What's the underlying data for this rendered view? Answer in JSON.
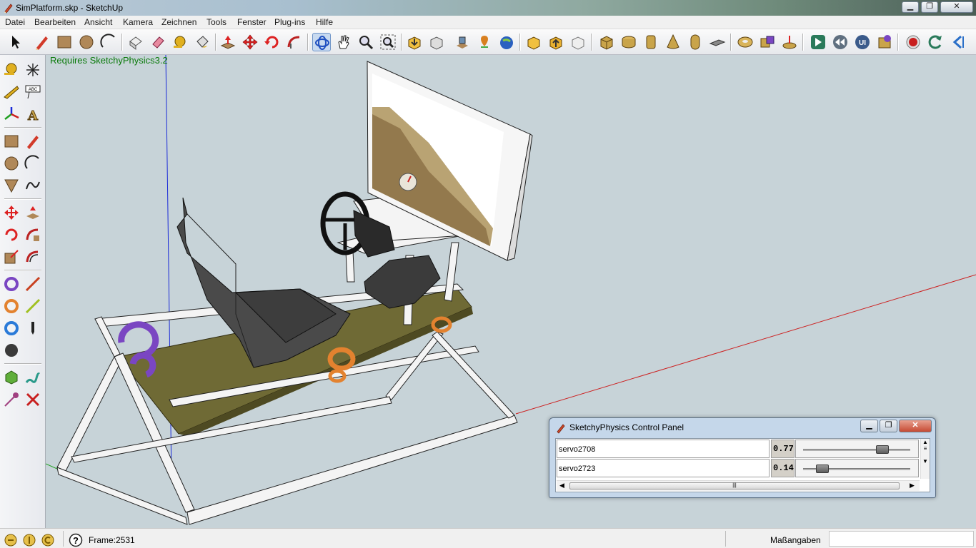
{
  "window": {
    "title": "SimPlatform.skp - SketchUp",
    "app_icon": "sketchup-pencil-icon"
  },
  "menu": {
    "items": [
      "Datei",
      "Bearbeiten",
      "Ansicht",
      "Kamera",
      "Zeichnen",
      "Tools",
      "Fenster",
      "Plug-ins",
      "Hilfe"
    ]
  },
  "toolbar": {
    "icons": [
      "select-arrow-icon",
      "pencil-line-icon",
      "rectangle-icon",
      "circle-icon",
      "arc-icon",
      "make-component-icon",
      "eraser-icon",
      "tape-measure-icon",
      "paint-bucket-icon",
      "push-pull-icon",
      "move-icon",
      "rotate-icon",
      "follow-me-icon",
      "orbit-icon",
      "pan-hand-icon",
      "zoom-icon",
      "zoom-extents-icon",
      "get-models-icon",
      "share-model-icon",
      "google-earth-icon",
      "add-location-icon",
      "toggle-terrain-icon",
      "get-photo-texture-icon",
      "share-component-icon",
      "preview-model-icon",
      "box-solid-icon",
      "cylinder-solid-icon",
      "tube-solid-icon",
      "cone-solid-icon",
      "capsule-solid-icon",
      "plate-solid-icon",
      "torus-solid-icon",
      "joint-connector-icon",
      "lift-icon",
      "play-simulation-icon",
      "rewind-simulation-icon",
      "ui-control-icon",
      "physics-settings-icon",
      "record-icon",
      "reset-icon",
      "kinect-icon"
    ]
  },
  "left_toolbar": {
    "icons": [
      "tape-measure-icon",
      "axes-icon",
      "protractor-icon",
      "text-label-icon",
      "axes-tool-icon",
      "3d-text-icon",
      "rectangle-icon",
      "line-icon",
      "circle-icon",
      "arc-icon",
      "polygon-icon",
      "freehand-icon",
      "move-icon",
      "push-pull-icon",
      "rotate-icon",
      "follow-me-icon",
      "scale-icon",
      "offset-icon",
      "hinge-joint-icon",
      "slider-joint-icon",
      "servo-joint-icon",
      "piston-joint-icon",
      "motor-joint-icon",
      "magnet-icon",
      "solid-ball-icon",
      "spring-icon",
      "tether-icon",
      "fixed-joint-icon"
    ]
  },
  "viewport": {
    "notice": "Requires SketchyPhysics3.2"
  },
  "status": {
    "frame": "Frame:2531",
    "measure_label": "Maßangaben",
    "measure_value": ""
  },
  "control_panel": {
    "title": "SketchyPhysics Control Panel",
    "rows": [
      {
        "name": "servo2708",
        "value": "0.77",
        "level": 0.77
      },
      {
        "name": "servo2723",
        "value": "0.14",
        "level": 0.14
      }
    ]
  },
  "colors": {
    "background": "#c7d3d8",
    "frame": "#f4f4f4",
    "platform": "#6f6a35",
    "seat": "#4a4a4a",
    "servo_orange": "#e3822f",
    "joint_purple": "#7a46c2",
    "notice_green": "#0a7a0a",
    "axis_red": "#cc2020",
    "axis_blue": "#1a2ad8",
    "axis_green": "#20a020"
  }
}
